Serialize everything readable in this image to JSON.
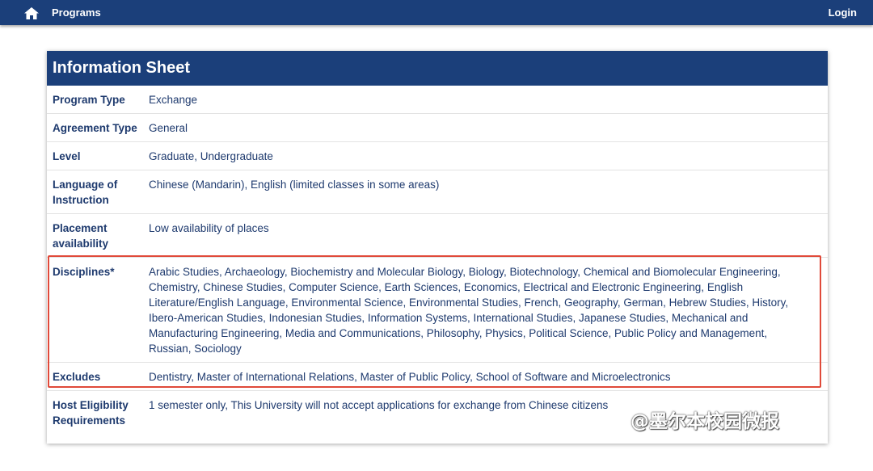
{
  "navbar": {
    "home_icon": "home-icon",
    "programs_label": "Programs",
    "login_label": "Login",
    "color": "#1b3f7a"
  },
  "sheet": {
    "title": "Information Sheet",
    "rows": [
      {
        "label": "Program Type",
        "value": "Exchange"
      },
      {
        "label": "Agreement Type",
        "value": "General"
      },
      {
        "label": "Level",
        "value": "Graduate, Undergraduate"
      },
      {
        "label": "Language of Instruction",
        "value": "Chinese (Mandarin), English (limited classes in some areas)"
      },
      {
        "label": "Placement availability",
        "value": "Low availability of places"
      },
      {
        "label": "Disciplines*",
        "value": "Arabic Studies, Archaeology, Biochemistry and Molecular Biology, Biology, Biotechnology, Chemical and Biomolecular Engineering, Chemistry, Chinese Studies, Computer Science, Earth Sciences, Economics, Electrical and Electronic Engineering, English Literature/English Language, Environmental Science, Environmental Studies, French, Geography, German, Hebrew Studies, History, Ibero-American Studies, Indonesian Studies, Information Systems, International Studies, Japanese Studies, Mechanical and Manufacturing Engineering, Media and Communications, Philosophy, Physics, Political Science, Public Policy and Management, Russian, Sociology"
      },
      {
        "label": "Excludes",
        "value": "Dentistry, Master of International Relations, Master of Public Policy, School of Software and Microelectronics"
      },
      {
        "label": "Host Eligibility Requirements",
        "value": "1 semester only, This University will not accept applications for exchange from Chinese citizens"
      }
    ]
  },
  "highlight_color": "#e04a3a",
  "watermark": "@墨尔本校园微报"
}
